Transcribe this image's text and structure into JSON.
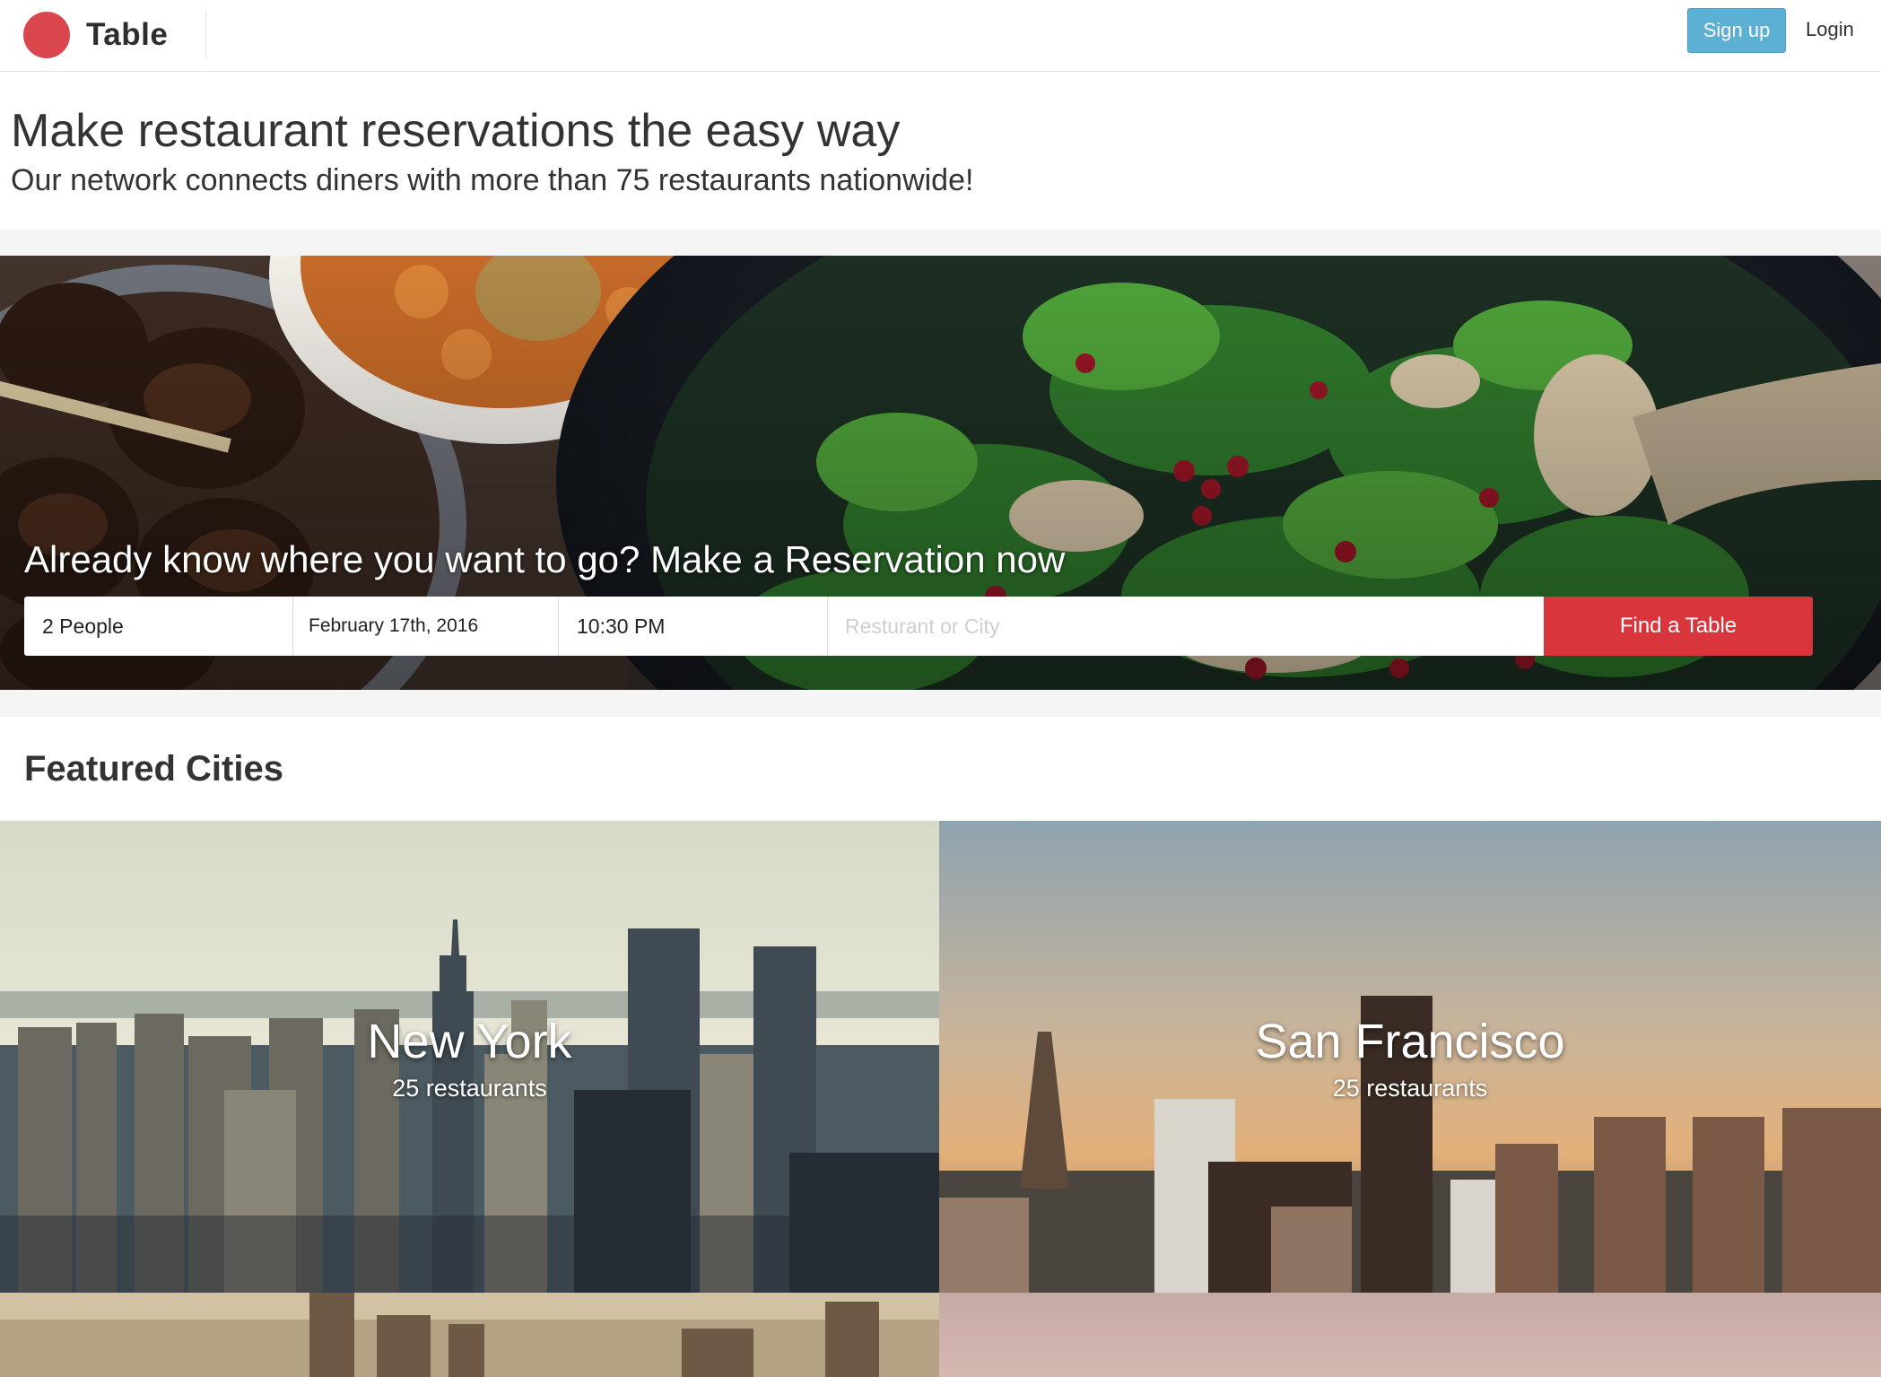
{
  "brand": {
    "name": "Table",
    "color": "#d9464b"
  },
  "nav": {
    "signup_label": "Sign up",
    "login_label": "Login"
  },
  "hero": {
    "headline": "Make restaurant reservations the easy way",
    "subheadline": "Our network connects diners with more than 75 restaurants nationwide!"
  },
  "reservation": {
    "title": "Already know where you want to go? Make a Reservation now",
    "party_size": "2 People",
    "date": "February 17th, 2016",
    "time": "10:30 PM",
    "search_placeholder": "Resturant or City",
    "search_value": "",
    "submit_label": "Find a Table"
  },
  "featured": {
    "title": "Featured Cities",
    "cities": [
      {
        "name": "New York",
        "count": "25 restaurants"
      },
      {
        "name": "San Francisco",
        "count": "25 restaurants"
      },
      {
        "name": "",
        "count": ""
      },
      {
        "name": "",
        "count": ""
      }
    ]
  },
  "colors": {
    "signup_button": "#5bb0d3",
    "find_button": "#d9353c",
    "band": "#f5f5f5"
  }
}
